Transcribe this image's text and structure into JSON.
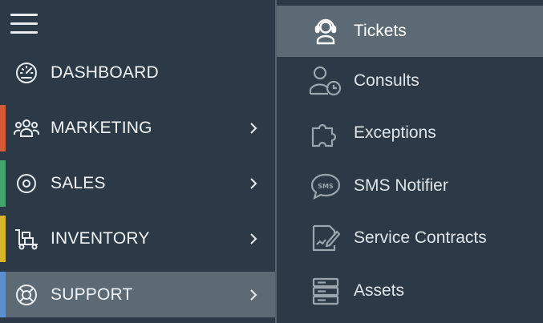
{
  "sidebar": {
    "items": [
      {
        "label": "DASHBOARD",
        "icon": "gauge-icon",
        "accent": null,
        "has_chevron": false
      },
      {
        "label": "MARKETING",
        "icon": "people-group-icon",
        "accent": "#d35a35",
        "has_chevron": true
      },
      {
        "label": "SALES",
        "icon": "target-icon",
        "accent": "#3fa56b",
        "has_chevron": true
      },
      {
        "label": "INVENTORY",
        "icon": "hand-truck-icon",
        "accent": "#d8b52a",
        "has_chevron": true
      },
      {
        "label": "SUPPORT",
        "icon": "lifebuoy-icon",
        "accent": "#5b8fcf",
        "has_chevron": true,
        "active": true
      }
    ]
  },
  "submenu": {
    "items": [
      {
        "label": "Tickets",
        "icon": "headset-agent-icon",
        "active": true
      },
      {
        "label": "Consults",
        "icon": "user-clock-icon"
      },
      {
        "label": "Exceptions",
        "icon": "puzzle-piece-icon"
      },
      {
        "label": "SMS Notifier",
        "icon": "sms-bubble-icon"
      },
      {
        "label": "Service Contracts",
        "icon": "contract-pen-icon"
      },
      {
        "label": "Assets",
        "icon": "server-stack-icon"
      }
    ]
  },
  "colors": {
    "background": "#2c3a47",
    "active_bg": "#5b6a75",
    "marketing": "#d35a35",
    "sales": "#3fa56b",
    "inventory": "#d8b52a",
    "support": "#5b8fcf"
  }
}
